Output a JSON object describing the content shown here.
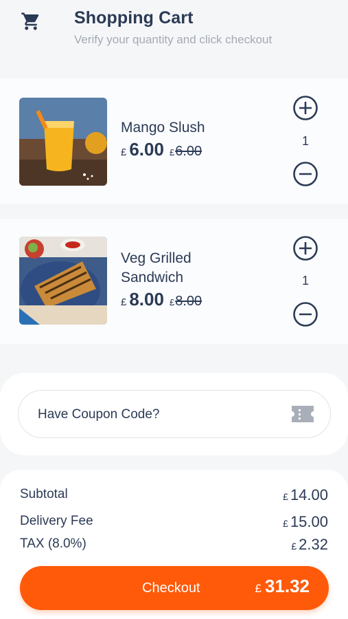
{
  "header": {
    "title": "Shopping Cart",
    "subtitle": "Verify your quantity and click checkout",
    "icon": "cart-icon"
  },
  "items": [
    {
      "name": "Mango Slush",
      "currency": "£",
      "price": "6.00",
      "old_price": "6.00",
      "quantity": "1"
    },
    {
      "name_line1": "Veg Grilled",
      "name_line2": "Sandwich",
      "currency": "£",
      "price": "8.00",
      "old_price": "8.00",
      "quantity": "1"
    }
  ],
  "coupon": {
    "label": "Have Coupon Code?",
    "icon": "ticket-icon"
  },
  "summary": {
    "subtotal_label": "Subtotal",
    "subtotal_currency": "£",
    "subtotal_value": "14.00",
    "delivery_label": "Delivery Fee",
    "delivery_currency": "£",
    "delivery_value": "15.00",
    "tax_label": "TAX (8.0%)",
    "tax_currency": "£",
    "tax_value": "2.32"
  },
  "checkout": {
    "label": "Checkout",
    "currency": "£",
    "total": "31.32"
  },
  "colors": {
    "accent": "#ff5a0a",
    "text": "#2b3a55",
    "muted": "#a3a9b4",
    "background": "#f5f6f8"
  }
}
